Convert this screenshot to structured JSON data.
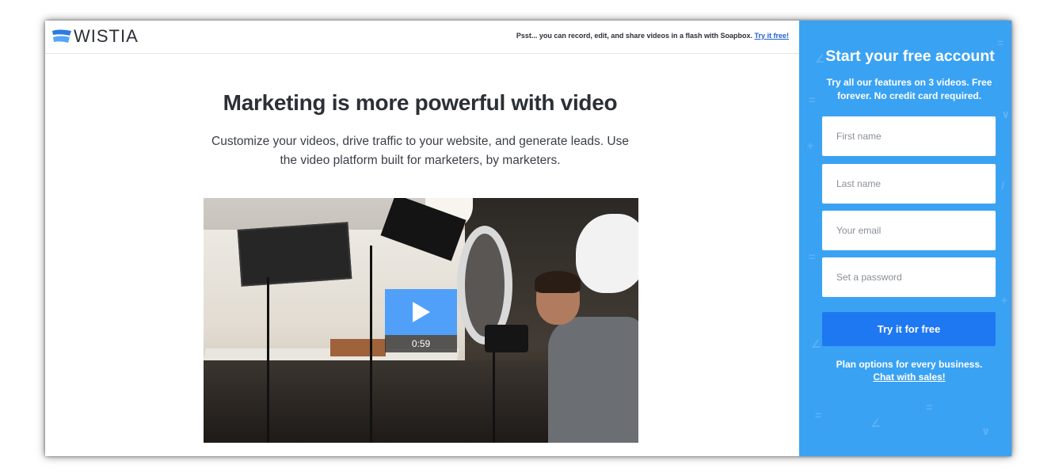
{
  "brand": {
    "name": "WISTIA",
    "logo_icon": "wistia-wave-icon",
    "logo_color": "#2b7be0"
  },
  "header": {
    "promo_text": "Psst... you can record, edit, and share videos in a flash with Soapbox.",
    "promo_link": "Try it free!"
  },
  "main": {
    "headline": "Marketing is more powerful with video",
    "subhead": "Customize your videos, drive traffic to your website, and generate leads. Use the video platform built for marketers, by marketers.",
    "video": {
      "duration": "0:59",
      "play_icon": "play-icon"
    }
  },
  "signup": {
    "title": "Start your free account",
    "subtitle": "Try all our features on 3 videos. Free forever. No credit card required.",
    "fields": {
      "first_name": {
        "placeholder": "First name",
        "value": ""
      },
      "last_name": {
        "placeholder": "Last name",
        "value": ""
      },
      "email": {
        "placeholder": "Your email",
        "value": ""
      },
      "password": {
        "placeholder": "Set a password",
        "value": ""
      }
    },
    "submit_label": "Try it for free",
    "plan_text": "Plan options for every business.",
    "chat_link": "Chat with sales!",
    "panel_color": "#3aa2f3",
    "button_color": "#1e78f2"
  }
}
